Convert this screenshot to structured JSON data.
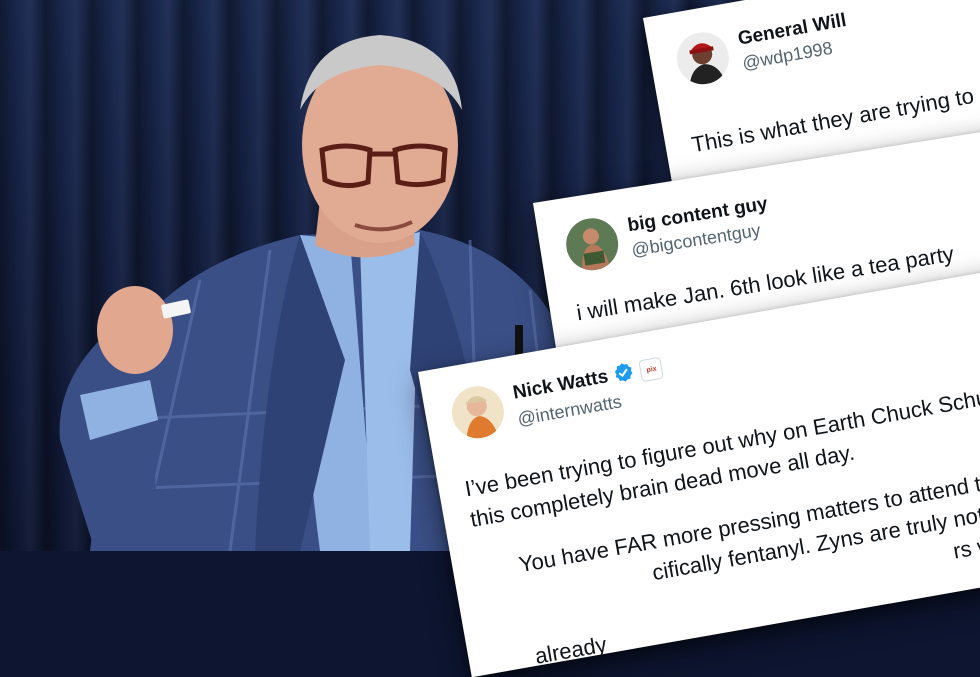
{
  "tweets": [
    {
      "name": "General Will",
      "handle": "@wdp1998",
      "text": "This is what they are trying to"
    },
    {
      "name": "big content guy",
      "handle": "@bigcontentguy",
      "text": "i will make Jan. 6th look like a tea party"
    },
    {
      "name": "Nick Watts",
      "handle": "@internwatts",
      "affiliate_badge": "pix",
      "verified": true,
      "text_line1": "I’ve been trying to figure out why on Earth Chuck Schum",
      "text_line2": "this completely brain dead move all day.",
      "text_line3": "You have FAR more pressing matters to attend to, s",
      "text_line4": "cifically fentanyl. Zyns are truly nothing",
      "text_line5": "rs who already"
    }
  ],
  "colors": {
    "verified_blue": "#1d9bf0",
    "text": "#0f1419",
    "secondary_text": "#536471",
    "curtain": "#1b2a52",
    "suit": "#3a4f86"
  }
}
